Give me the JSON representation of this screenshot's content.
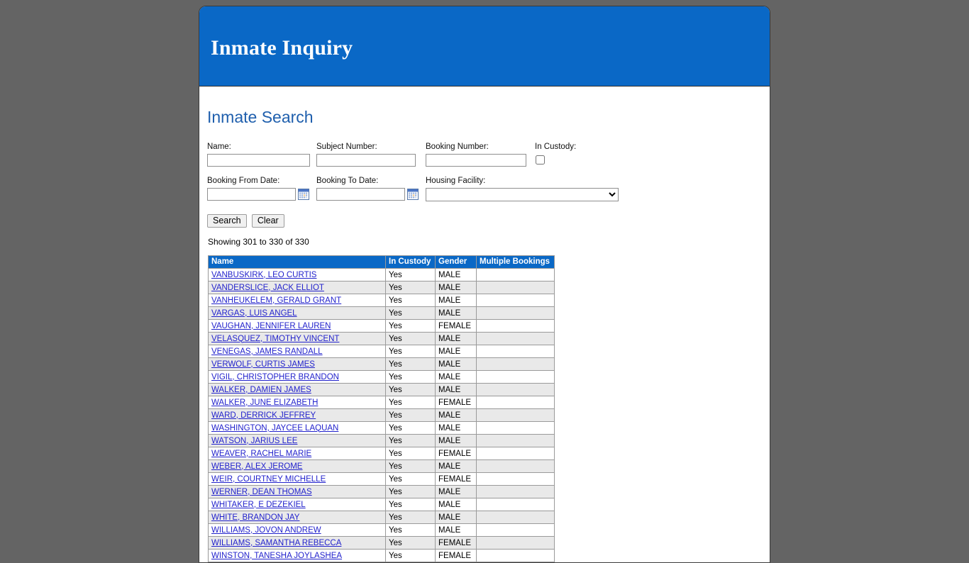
{
  "banner": {
    "title": "Inmate Inquiry"
  },
  "section": {
    "title": "Inmate Search"
  },
  "search_form": {
    "name": {
      "label": "Name:",
      "value": "",
      "placeholder": ""
    },
    "subject_number": {
      "label": "Subject Number:",
      "value": "",
      "placeholder": ""
    },
    "booking_number": {
      "label": "Booking Number:",
      "value": "",
      "placeholder": ""
    },
    "in_custody": {
      "label": "In Custody:",
      "checked": false
    },
    "booking_from_date": {
      "label": "Booking From Date:",
      "value": "",
      "placeholder": "",
      "icon": "calendar-icon"
    },
    "booking_to_date": {
      "label": "Booking To Date:",
      "value": "",
      "placeholder": "",
      "icon": "calendar-icon"
    },
    "housing_facility": {
      "label": "Housing Facility:",
      "selected": "",
      "options": [
        ""
      ]
    },
    "search_button": "Search",
    "clear_button": "Clear"
  },
  "results": {
    "showing": "Showing 301 to 330 of 330",
    "columns": [
      "Name",
      "In Custody",
      "Gender",
      "Multiple Bookings"
    ],
    "rows": [
      {
        "name": "VANBUSKIRK, LEO CURTIS",
        "in_custody": "Yes",
        "gender": "MALE",
        "multiple_bookings": ""
      },
      {
        "name": "VANDERSLICE, JACK ELLIOT",
        "in_custody": "Yes",
        "gender": "MALE",
        "multiple_bookings": ""
      },
      {
        "name": "VANHEUKELEM, GERALD GRANT",
        "in_custody": "Yes",
        "gender": "MALE",
        "multiple_bookings": ""
      },
      {
        "name": "VARGAS, LUIS ANGEL",
        "in_custody": "Yes",
        "gender": "MALE",
        "multiple_bookings": ""
      },
      {
        "name": "VAUGHAN, JENNIFER LAUREN",
        "in_custody": "Yes",
        "gender": "FEMALE",
        "multiple_bookings": ""
      },
      {
        "name": "VELASQUEZ, TIMOTHY VINCENT",
        "in_custody": "Yes",
        "gender": "MALE",
        "multiple_bookings": ""
      },
      {
        "name": "VENEGAS, JAMES RANDALL",
        "in_custody": "Yes",
        "gender": "MALE",
        "multiple_bookings": ""
      },
      {
        "name": "VERWOLF, CURTIS JAMES",
        "in_custody": "Yes",
        "gender": "MALE",
        "multiple_bookings": ""
      },
      {
        "name": "VIGIL, CHRISTOPHER BRANDON",
        "in_custody": "Yes",
        "gender": "MALE",
        "multiple_bookings": ""
      },
      {
        "name": "WALKER, DAMIEN JAMES",
        "in_custody": "Yes",
        "gender": "MALE",
        "multiple_bookings": ""
      },
      {
        "name": "WALKER, JUNE ELIZABETH",
        "in_custody": "Yes",
        "gender": "FEMALE",
        "multiple_bookings": ""
      },
      {
        "name": "WARD, DERRICK JEFFREY",
        "in_custody": "Yes",
        "gender": "MALE",
        "multiple_bookings": ""
      },
      {
        "name": "WASHINGTON, JAYCEE LAQUAN",
        "in_custody": "Yes",
        "gender": "MALE",
        "multiple_bookings": ""
      },
      {
        "name": "WATSON, JARIUS LEE",
        "in_custody": "Yes",
        "gender": "MALE",
        "multiple_bookings": ""
      },
      {
        "name": "WEAVER, RACHEL MARIE",
        "in_custody": "Yes",
        "gender": "FEMALE",
        "multiple_bookings": ""
      },
      {
        "name": "WEBER, ALEX JEROME",
        "in_custody": "Yes",
        "gender": "MALE",
        "multiple_bookings": ""
      },
      {
        "name": "WEIR, COURTNEY MICHELLE",
        "in_custody": "Yes",
        "gender": "FEMALE",
        "multiple_bookings": ""
      },
      {
        "name": "WERNER, DEAN THOMAS",
        "in_custody": "Yes",
        "gender": "MALE",
        "multiple_bookings": ""
      },
      {
        "name": "WHITAKER, E DEZEKIEL",
        "in_custody": "Yes",
        "gender": "MALE",
        "multiple_bookings": ""
      },
      {
        "name": "WHITE, BRANDON JAY",
        "in_custody": "Yes",
        "gender": "MALE",
        "multiple_bookings": ""
      },
      {
        "name": "WILLIAMS, JOVON ANDREW",
        "in_custody": "Yes",
        "gender": "MALE",
        "multiple_bookings": ""
      },
      {
        "name": "WILLIAMS, SAMANTHA REBECCA",
        "in_custody": "Yes",
        "gender": "FEMALE",
        "multiple_bookings": ""
      },
      {
        "name": "WINSTON, TANESHA JOYLASHEA",
        "in_custody": "Yes",
        "gender": "FEMALE",
        "multiple_bookings": ""
      }
    ]
  },
  "colors": {
    "banner_blue": "#0a68c6",
    "page_background": "#646464",
    "heading_blue": "#1f5fad",
    "link_blue": "#2222cc",
    "row_alt": "#e9e9e9"
  }
}
